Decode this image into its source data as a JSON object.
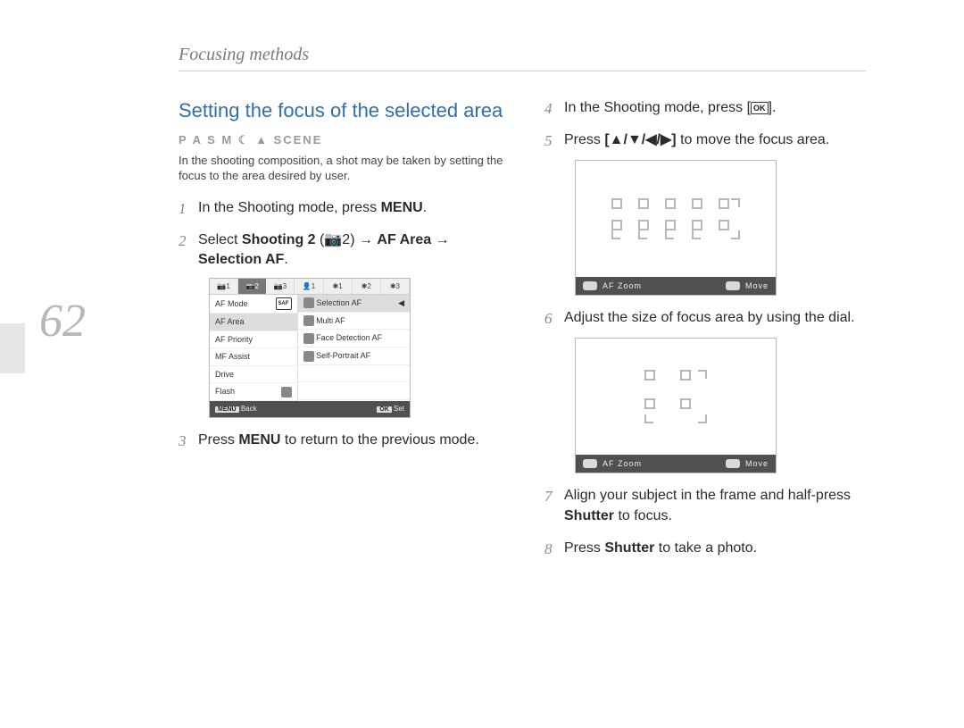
{
  "page_number": "62",
  "section_header": "Focusing methods",
  "heading": "Setting the focus of the selected area",
  "mode_line": "P A S M ☾ ▲ SCENE",
  "intro": "In the shooting composition, a shot may be taken by setting the focus to the area desired by user.",
  "steps": {
    "s1_pre": "In the Shooting mode, press ",
    "s1_bold": "MENU",
    "s1_post": ".",
    "s2_pre": "Select ",
    "s2_b1": "Shooting 2",
    "s2_mid1": " (",
    "s2_cam": "📷2",
    "s2_mid2": ") → ",
    "s2_b2": "AF Area",
    "s2_mid3": " → ",
    "s2_b3": "Selection AF",
    "s2_post": ".",
    "s3_pre": "Press ",
    "s3_b": "MENU",
    "s3_post": " to return to the previous mode.",
    "s4_pre": "In the Shooting mode, press [",
    "s4_icon": "OK",
    "s4_post": "].",
    "s5_pre": "Press ",
    "s5_b": "[▲/▼/◀/▶]",
    "s5_post": " to move the focus area.",
    "s6": "Adjust the size of focus area by using the dial.",
    "s7_pre": "Align your subject in the frame and half-press ",
    "s7_b": "Shutter",
    "s7_post": " to focus.",
    "s8_pre": "Press ",
    "s8_b": "Shutter",
    "s8_post": " to take a photo."
  },
  "menu": {
    "tabs": [
      "📷1",
      "📷2",
      "📷3",
      "👤1",
      "✱1",
      "✱2",
      "✱3"
    ],
    "active_tab_index": 1,
    "left_items": [
      "AF Mode",
      "AF Area",
      "AF Priority",
      "MF Assist",
      "Drive",
      "Flash"
    ],
    "left_selected_index": 1,
    "right_items": [
      "Selection AF",
      "Multi AF",
      "Face Detection AF",
      "Self-Portrait AF"
    ],
    "right_selected_index": 0,
    "top_right_icon": "SAF",
    "footer": {
      "back_btn": "MENU",
      "back_label": " Back",
      "set_btn": "OK",
      "set_label": " Set"
    }
  },
  "live": {
    "af_zoom": "AF Zoom",
    "move": "Move"
  }
}
